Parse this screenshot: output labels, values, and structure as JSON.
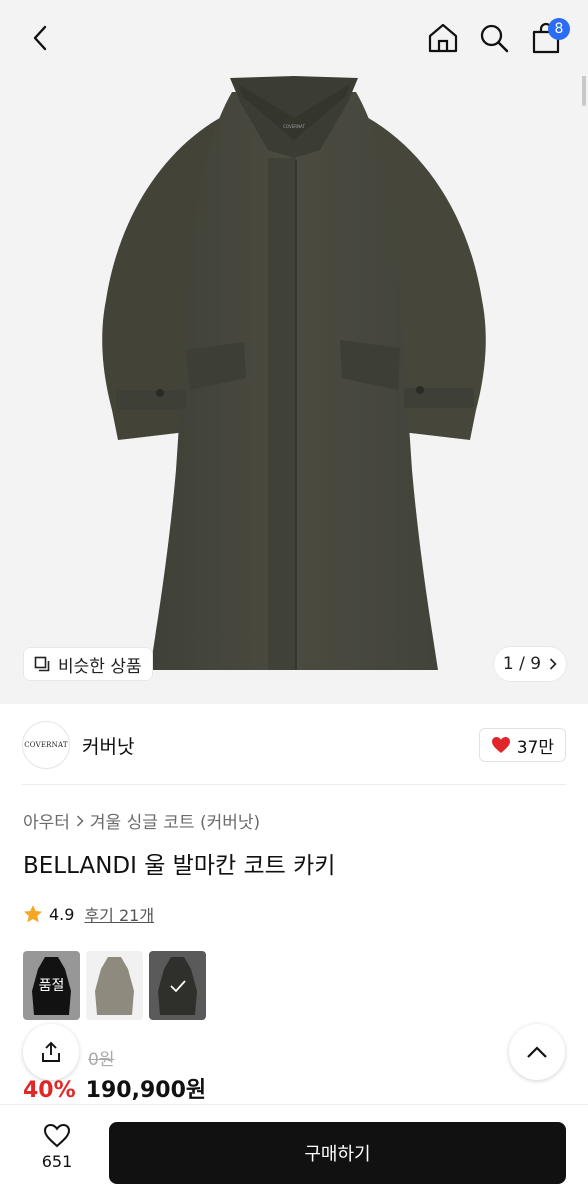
{
  "header": {
    "back_icon": "chevron-left-icon",
    "home_icon": "home-icon",
    "search_icon": "search-icon",
    "cart_icon": "shopping-bag-icon",
    "cart_count": "8"
  },
  "gallery": {
    "similar_label": "비슷한 상품",
    "pager": "1 / 9",
    "coat_brand_print": "COVERNAT"
  },
  "brand": {
    "logo_text": "COVERNAT",
    "name": "커버낫",
    "likes": "37만"
  },
  "product": {
    "breadcrumb": [
      "아우터",
      "겨울 싱글 코트 (커버낫)"
    ],
    "title": "BELLANDI 울 발마칸 코트 카키",
    "rating": "4.9",
    "reviews": "후기 21개",
    "swatches": [
      {
        "name": "black",
        "label": "품절",
        "color": "#1c1c1c",
        "soldout": true
      },
      {
        "name": "grey-khaki",
        "label": "",
        "color": "#8e8a7e",
        "soldout": false
      },
      {
        "name": "khaki",
        "label": "",
        "color": "#2f2f2c",
        "selected": true
      }
    ],
    "old_price_partial": "0원",
    "discount": "40%",
    "price": "190,900원"
  },
  "bottom": {
    "wish_count": "651",
    "buy_label": "구매하기"
  },
  "colors": {
    "accent_blue": "#2b6cf6",
    "discount_red": "#e02828",
    "heart_red": "#e0262b",
    "star_orange": "#f5a623",
    "coat": "#4a4a3e"
  }
}
